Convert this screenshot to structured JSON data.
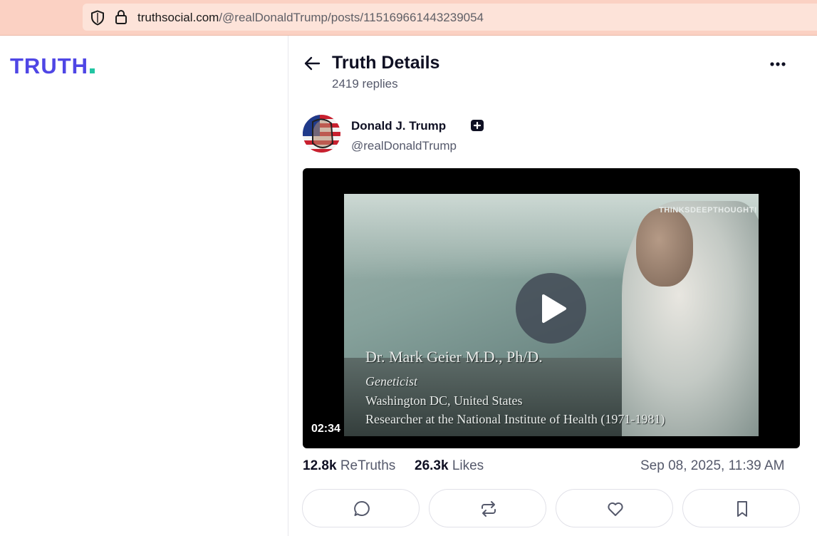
{
  "browser": {
    "url_host": "truthsocial.com",
    "url_path": "/@realDonaldTrump/posts/115169661443239054"
  },
  "logo": {
    "text": "TRUTH"
  },
  "header": {
    "title": "Truth Details",
    "reply_count": "2419 replies"
  },
  "post": {
    "author_name": "Donald J. Trump",
    "author_handle": "@realDonaldTrump",
    "video": {
      "watermark": "THINKSDEEPTHOUGHT!",
      "caption_name": "Dr. Mark Geier M.D., Ph/D.",
      "caption_role": "Geneticist",
      "caption_location": "Washington DC, United States",
      "caption_bio": "Researcher at the National Institute of Health (1971-1981)",
      "duration": "02:34"
    },
    "stats": {
      "retruths_count": "12.8k",
      "retruths_label": "ReTruths",
      "likes_count": "26.3k",
      "likes_label": "Likes"
    },
    "timestamp": "Sep 08, 2025, 11:39 AM"
  },
  "icons": {
    "back": "arrow-left-icon",
    "more": "more-horizontal-icon",
    "verified": "verified-badge-icon",
    "reply": "comment-icon",
    "retruth": "repeat-icon",
    "like": "heart-icon",
    "bookmark": "bookmark-icon"
  },
  "colors": {
    "brand": "#4f46e5",
    "brand_dot": "#22c5a3",
    "browser_bar": "#fbd1c3"
  }
}
